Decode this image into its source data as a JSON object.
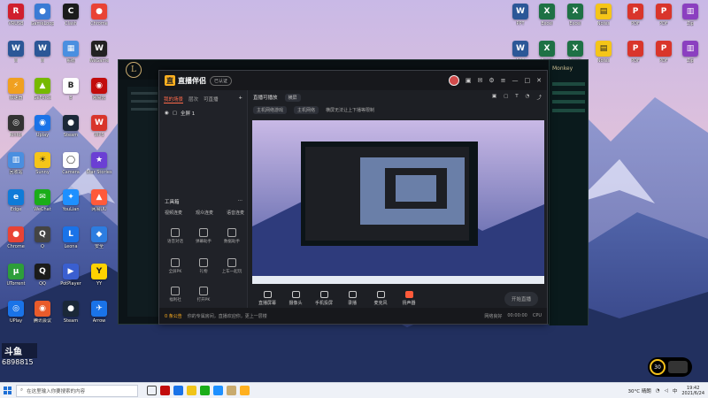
{
  "desktop": {
    "icons": [
      {
        "label": "VRUSB",
        "glyph": "R",
        "color": "#d01f2e"
      },
      {
        "label": "GameLoop",
        "glyph": "●",
        "color": "#3a7bd5"
      },
      {
        "label": "Clash",
        "glyph": "C",
        "color": "#1b1b1b"
      },
      {
        "label": "Chrome",
        "glyph": "●",
        "color": "#e94335"
      },
      {
        "label": "W",
        "glyph": "W",
        "color": "#2b5797"
      },
      {
        "label": "W",
        "glyph": "W",
        "color": "#2b5797"
      },
      {
        "label": "系统",
        "glyph": "▦",
        "color": "#4a8fe0"
      },
      {
        "label": "WeGame",
        "glyph": "W",
        "color": "#222"
      },
      {
        "label": "加速器",
        "glyph": "⚡",
        "color": "#f0a020"
      },
      {
        "label": "GeForce",
        "glyph": "▲",
        "color": "#76b900"
      },
      {
        "label": "B",
        "glyph": "B",
        "color": "#fff"
      },
      {
        "label": "网易云",
        "glyph": "◉",
        "color": "#c20c0c"
      },
      {
        "label": "Rinfor",
        "glyph": "◎",
        "color": "#333"
      },
      {
        "label": "Uplay",
        "glyph": "◉",
        "color": "#1a73e8"
      },
      {
        "label": "Steam",
        "glyph": "●",
        "color": "#1b2838"
      },
      {
        "label": "WPS",
        "glyph": "W",
        "color": "#d9352b"
      },
      {
        "label": "回收站",
        "glyph": "▥",
        "color": "#4a8fe0"
      },
      {
        "label": "Sunny",
        "glyph": "☀",
        "color": "#f5c518"
      },
      {
        "label": "Camera",
        "glyph": "◯",
        "color": "#fff"
      },
      {
        "label": "Star Stories",
        "glyph": "★",
        "color": "#6b3fd4"
      },
      {
        "label": "Edge",
        "glyph": "e",
        "color": "#0f7bd8"
      },
      {
        "label": "WeChat",
        "glyph": "✉",
        "color": "#1aad19"
      },
      {
        "label": "YouLian",
        "glyph": "✦",
        "color": "#1e90ff"
      },
      {
        "label": "网易UU",
        "glyph": "▲",
        "color": "#ff5a3a"
      },
      {
        "label": "Chrome",
        "glyph": "●",
        "color": "#e94335"
      },
      {
        "label": "Q",
        "glyph": "Q",
        "color": "#444"
      },
      {
        "label": "Leona",
        "glyph": "L",
        "color": "#1a73e8"
      },
      {
        "label": "安全",
        "glyph": "◆",
        "color": "#2d7de0"
      },
      {
        "label": "UTorrent",
        "glyph": "μ",
        "color": "#2d9e3a"
      },
      {
        "label": "QQ",
        "glyph": "Q",
        "color": "#1b1b1b"
      },
      {
        "label": "PotPlayer",
        "glyph": "▶",
        "color": "#3a5fd0"
      },
      {
        "label": "YY",
        "glyph": "Y",
        "color": "#ffd200"
      },
      {
        "label": "UPlay",
        "glyph": "◎",
        "color": "#1a73e8"
      },
      {
        "label": "腾讯会议",
        "glyph": "◉",
        "color": "#e95b2b"
      },
      {
        "label": "Steam",
        "glyph": "●",
        "color": "#1b2838"
      },
      {
        "label": "Arrow",
        "glyph": "✈",
        "color": "#1a73e8"
      }
    ],
    "right_icons": [
      {
        "label": "PPT",
        "glyph": "W",
        "color": "#2b5797"
      },
      {
        "label": "Excel",
        "glyph": "X",
        "color": "#1e7145"
      },
      {
        "label": "Excel",
        "glyph": "X",
        "color": "#1e7145"
      },
      {
        "label": "Notes",
        "glyph": "▤",
        "color": "#f5c518"
      },
      {
        "label": "PDF",
        "glyph": "P",
        "color": "#d9352b"
      },
      {
        "label": "PDF",
        "glyph": "P",
        "color": "#d9352b"
      },
      {
        "label": "Zip",
        "glyph": "▥",
        "color": "#8b3fc0"
      }
    ],
    "lol_client": {
      "side_name": "Monkey"
    }
  },
  "stream_app": {
    "title": "直播伴侣",
    "badge": "已认证",
    "tabs": [
      "我的场景",
      "层次",
      "可直播"
    ],
    "scene_label": "全屏 1",
    "tools_title": "工具箱",
    "tools_more_icon": "more-icon",
    "tools_sub": [
      "视频连麦",
      "观众连麦",
      "语音连麦"
    ],
    "tools": [
      "语音对话",
      "弹幕助手",
      "数据助手",
      "全屏PK",
      "礼物",
      "上车一起玩",
      "福利社",
      "打开PK"
    ],
    "main_top": {
      "label": "直播可播放",
      "pill": "横屏"
    },
    "main_row": {
      "pill1": "主机网络游戏",
      "pill2": "主机网络",
      "note": "横屏无法让上下播等限制"
    },
    "controls": [
      {
        "label": "直播屏幕",
        "icon": "screen-icon"
      },
      {
        "label": "摄像头",
        "icon": "camera-icon"
      },
      {
        "label": "手机投屏",
        "icon": "phone-icon"
      },
      {
        "label": "录播",
        "icon": "record-icon"
      },
      {
        "label": "麦克风",
        "icon": "mic-icon"
      },
      {
        "label": "扬声器",
        "icon": "speaker-icon"
      }
    ],
    "start_button": "开始直播",
    "status": {
      "warn": "0 条公告",
      "text": "你的专属房间，直播欢迎你，更上一层楼",
      "right": [
        "网络良好",
        "00:00:00",
        "CPU"
      ]
    }
  },
  "overlay": {
    "corner_logo": "斗鱼",
    "corner_number": "6898815",
    "fps_value": "30"
  },
  "taskbar": {
    "search_placeholder": "在这里输入你要搜索的内容",
    "tray_temp": "30°C 晴朗",
    "tray_lang": "中",
    "time": "19:42",
    "date": "2021/6/24"
  }
}
